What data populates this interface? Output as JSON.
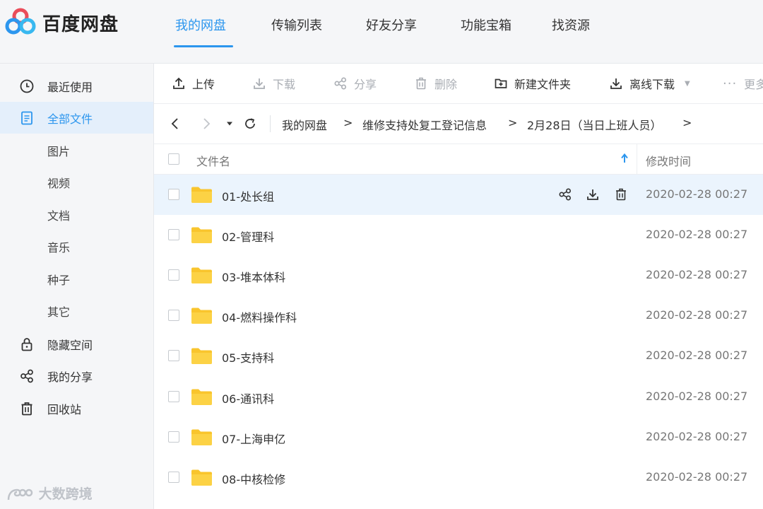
{
  "header": {
    "brand": "百度网盘",
    "tabs": [
      {
        "label": "我的网盘",
        "active": true
      },
      {
        "label": "传输列表",
        "active": false
      },
      {
        "label": "好友分享",
        "active": false
      },
      {
        "label": "功能宝箱",
        "active": false
      },
      {
        "label": "找资源",
        "active": false
      }
    ]
  },
  "sidebar": {
    "items": [
      {
        "label": "最近使用",
        "icon": "clock-icon"
      },
      {
        "label": "全部文件",
        "icon": "document-icon",
        "active": true
      },
      {
        "label": "图片"
      },
      {
        "label": "视频"
      },
      {
        "label": "文档"
      },
      {
        "label": "音乐"
      },
      {
        "label": "种子"
      },
      {
        "label": "其它"
      },
      {
        "label": "隐藏空间",
        "icon": "lock-icon"
      },
      {
        "label": "我的分享",
        "icon": "share-icon"
      },
      {
        "label": "回收站",
        "icon": "trash-icon"
      }
    ],
    "watermark": "大数跨境"
  },
  "toolbar": {
    "upload": "上传",
    "download": "下载",
    "share": "分享",
    "delete": "删除",
    "new_folder": "新建文件夹",
    "offline_download": "离线下载",
    "more": "更多"
  },
  "breadcrumb": {
    "items": [
      "我的网盘",
      "维修支持处复工登记信息",
      "2月28日（当日上班人员）"
    ],
    "separator": ">"
  },
  "table": {
    "col_name": "文件名",
    "col_time": "修改时间",
    "rows": [
      {
        "name": "01-处长组",
        "time": "2020-02-28 00:27"
      },
      {
        "name": "02-管理科",
        "time": "2020-02-28 00:27"
      },
      {
        "name": "03-堆本体科",
        "time": "2020-02-28 00:27"
      },
      {
        "name": "04-燃料操作科",
        "time": "2020-02-28 00:27"
      },
      {
        "name": "05-支持科",
        "time": "2020-02-28 00:27"
      },
      {
        "name": "06-通讯科",
        "time": "2020-02-28 00:27"
      },
      {
        "name": "07-上海申亿",
        "time": "2020-02-28 00:27"
      },
      {
        "name": "08-中核检修",
        "time": "2020-02-28 00:27"
      }
    ]
  },
  "colors": {
    "accent": "#2c96ee",
    "folder": "#f9c52d",
    "row_hover": "#ebf4fd",
    "sidebar_bg": "#f5f6f8"
  }
}
